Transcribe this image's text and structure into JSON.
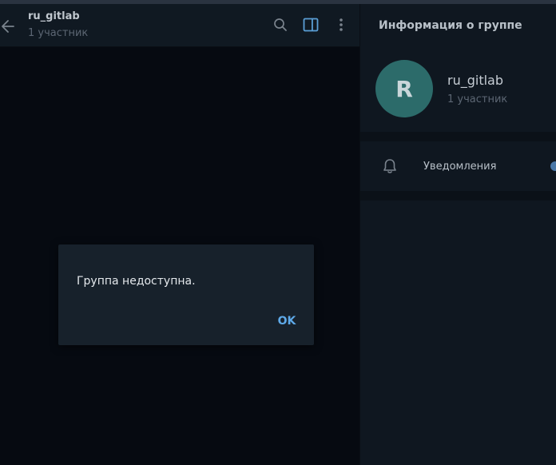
{
  "chat": {
    "title": "ru_gitlab",
    "subtitle": "1 участник"
  },
  "header_icons": {
    "back": "arrow-left-icon",
    "search": "search-icon",
    "sidebar_toggle": "sidebar-panel-icon",
    "more": "more-vertical-icon"
  },
  "info_panel": {
    "title": "Информация о группе",
    "avatar_letter": "R",
    "avatar_color": "#2c6b6a",
    "group_name": "ru_gitlab",
    "members": "1 участник",
    "notifications_label": "Уведомления"
  },
  "modal": {
    "message": "Группа недоступна.",
    "ok_label": "OK"
  },
  "colors": {
    "accent": "#5ea9e8",
    "active_icon": "#5a9fd6"
  }
}
